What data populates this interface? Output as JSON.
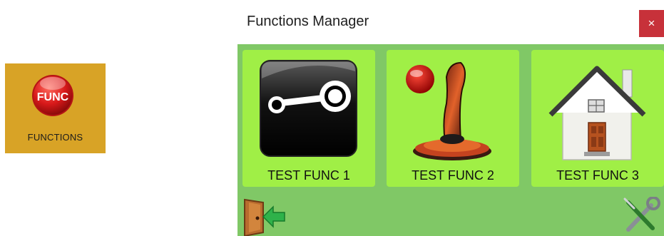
{
  "desktop": {
    "icon_text": "FUNC",
    "label": "FUNCTIONS",
    "icon": "func-orb-icon"
  },
  "window": {
    "title": "Functions Manager",
    "close_label": "×",
    "functions": [
      {
        "label": "TEST FUNC 1",
        "icon": "steam-icon"
      },
      {
        "label": "TEST FUNC 2",
        "icon": "joystick-icon"
      },
      {
        "label": "TEST FUNC 3",
        "icon": "house-icon"
      }
    ],
    "footer": {
      "exit_icon": "exit-door-icon",
      "settings_icon": "tools-icon"
    }
  },
  "colors": {
    "desktop_tile": "#d8a326",
    "content_bg": "#80c866",
    "tile_bg": "#a0ef46",
    "close_bg": "#c7313a"
  }
}
